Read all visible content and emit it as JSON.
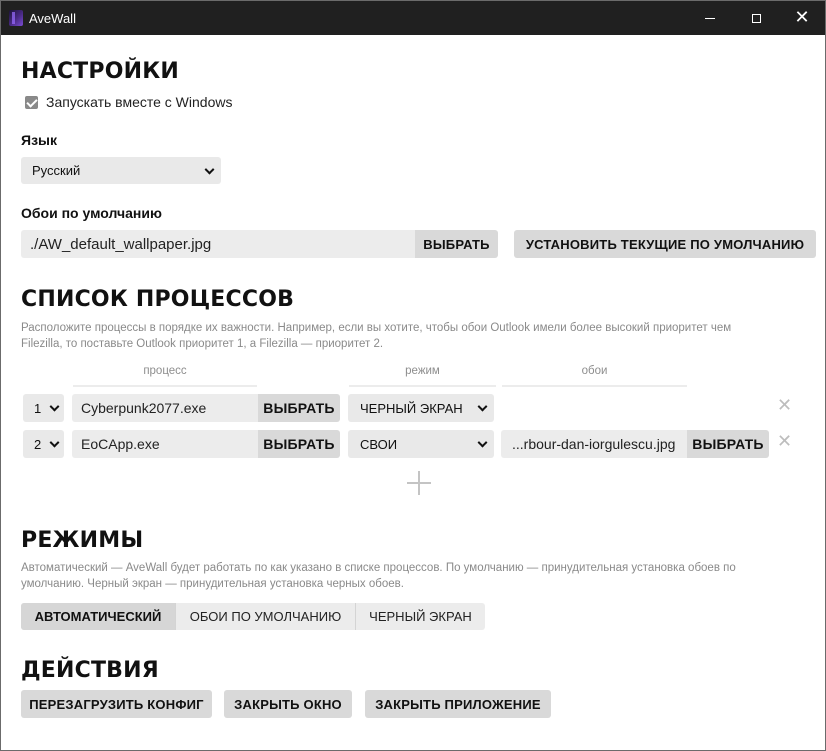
{
  "window": {
    "title": "AveWall",
    "icon": "avewall-app-icon",
    "controls": {
      "minimize": "minimize-icon",
      "maximize": "maximize-icon",
      "close": "close-icon"
    }
  },
  "settings": {
    "heading": "НАСТРОЙКИ",
    "autostart_label": "Запускать вместе с Windows",
    "autostart_checked": true,
    "language_heading": "Язык",
    "language_value": "Русский",
    "default_wallpaper_heading": "Обои по умолчанию",
    "default_wallpaper_path": "./AW_default_wallpaper.jpg",
    "choose_label": "ВЫБРАТЬ",
    "set_current_default_label": "УСТАНОВИТЬ ТЕКУЩИЕ ПО УМОЛЧАНИЮ"
  },
  "process_list": {
    "heading": "СПИСОК ПРОЦЕССОВ",
    "note_line1": "Расположите процессы в порядке их важности. Например, если вы хотите, чтобы обои Outlook имели более высокий приоритет чем",
    "note_line2": "Filezilla, то поставьте Outlook приоритет 1, а Filezilla — приоритет 2.",
    "columns": {
      "process": "процесс",
      "mode": "режим",
      "wallpaper": "обои"
    },
    "rows": [
      {
        "priority": "1",
        "process": "Cyberpunk2077.exe",
        "choose": "ВЫБРАТЬ",
        "mode": "ЧЕРНЫЙ ЭКРАН",
        "wallpaper": "",
        "wallpaper_choose": ""
      },
      {
        "priority": "2",
        "process": "EoCApp.exe",
        "choose": "ВЫБРАТЬ",
        "mode": "СВОИ",
        "wallpaper": "...rbour-dan-iorgulescu.jpg",
        "wallpaper_choose": "ВЫБРАТЬ"
      }
    ],
    "remove_icon": "close-x-icon",
    "add_icon": "plus-icon"
  },
  "modes": {
    "heading": "РЕЖИМЫ",
    "note_line1": "Автоматический — AveWall будет работать по как указано в списке процессов. По умолчанию — принудительная установка обоев по",
    "note_line2": "умолчанию. Черный экран — принудительная установка черных обоев.",
    "options": [
      "АВТОМАТИЧЕСКИЙ",
      "ОБОИ ПО УМОЛЧАНИЮ",
      "ЧЕРНЫЙ ЭКРАН"
    ],
    "selected": "АВТОМАТИЧЕСКИЙ"
  },
  "actions": {
    "heading": "ДЕЙСТВИЯ",
    "reload_config": "ПЕРЕЗАГРУЗИТЬ КОНФИГ",
    "close_window": "ЗАКРЫТЬ ОКНО",
    "close_app": "ЗАКРЫТЬ ПРИЛОЖЕНИЕ"
  },
  "colors": {
    "titlebar": "#202020",
    "button_bg": "#d9d9d9",
    "field_bg": "#ececec",
    "muted_text": "#8a8a8a"
  }
}
